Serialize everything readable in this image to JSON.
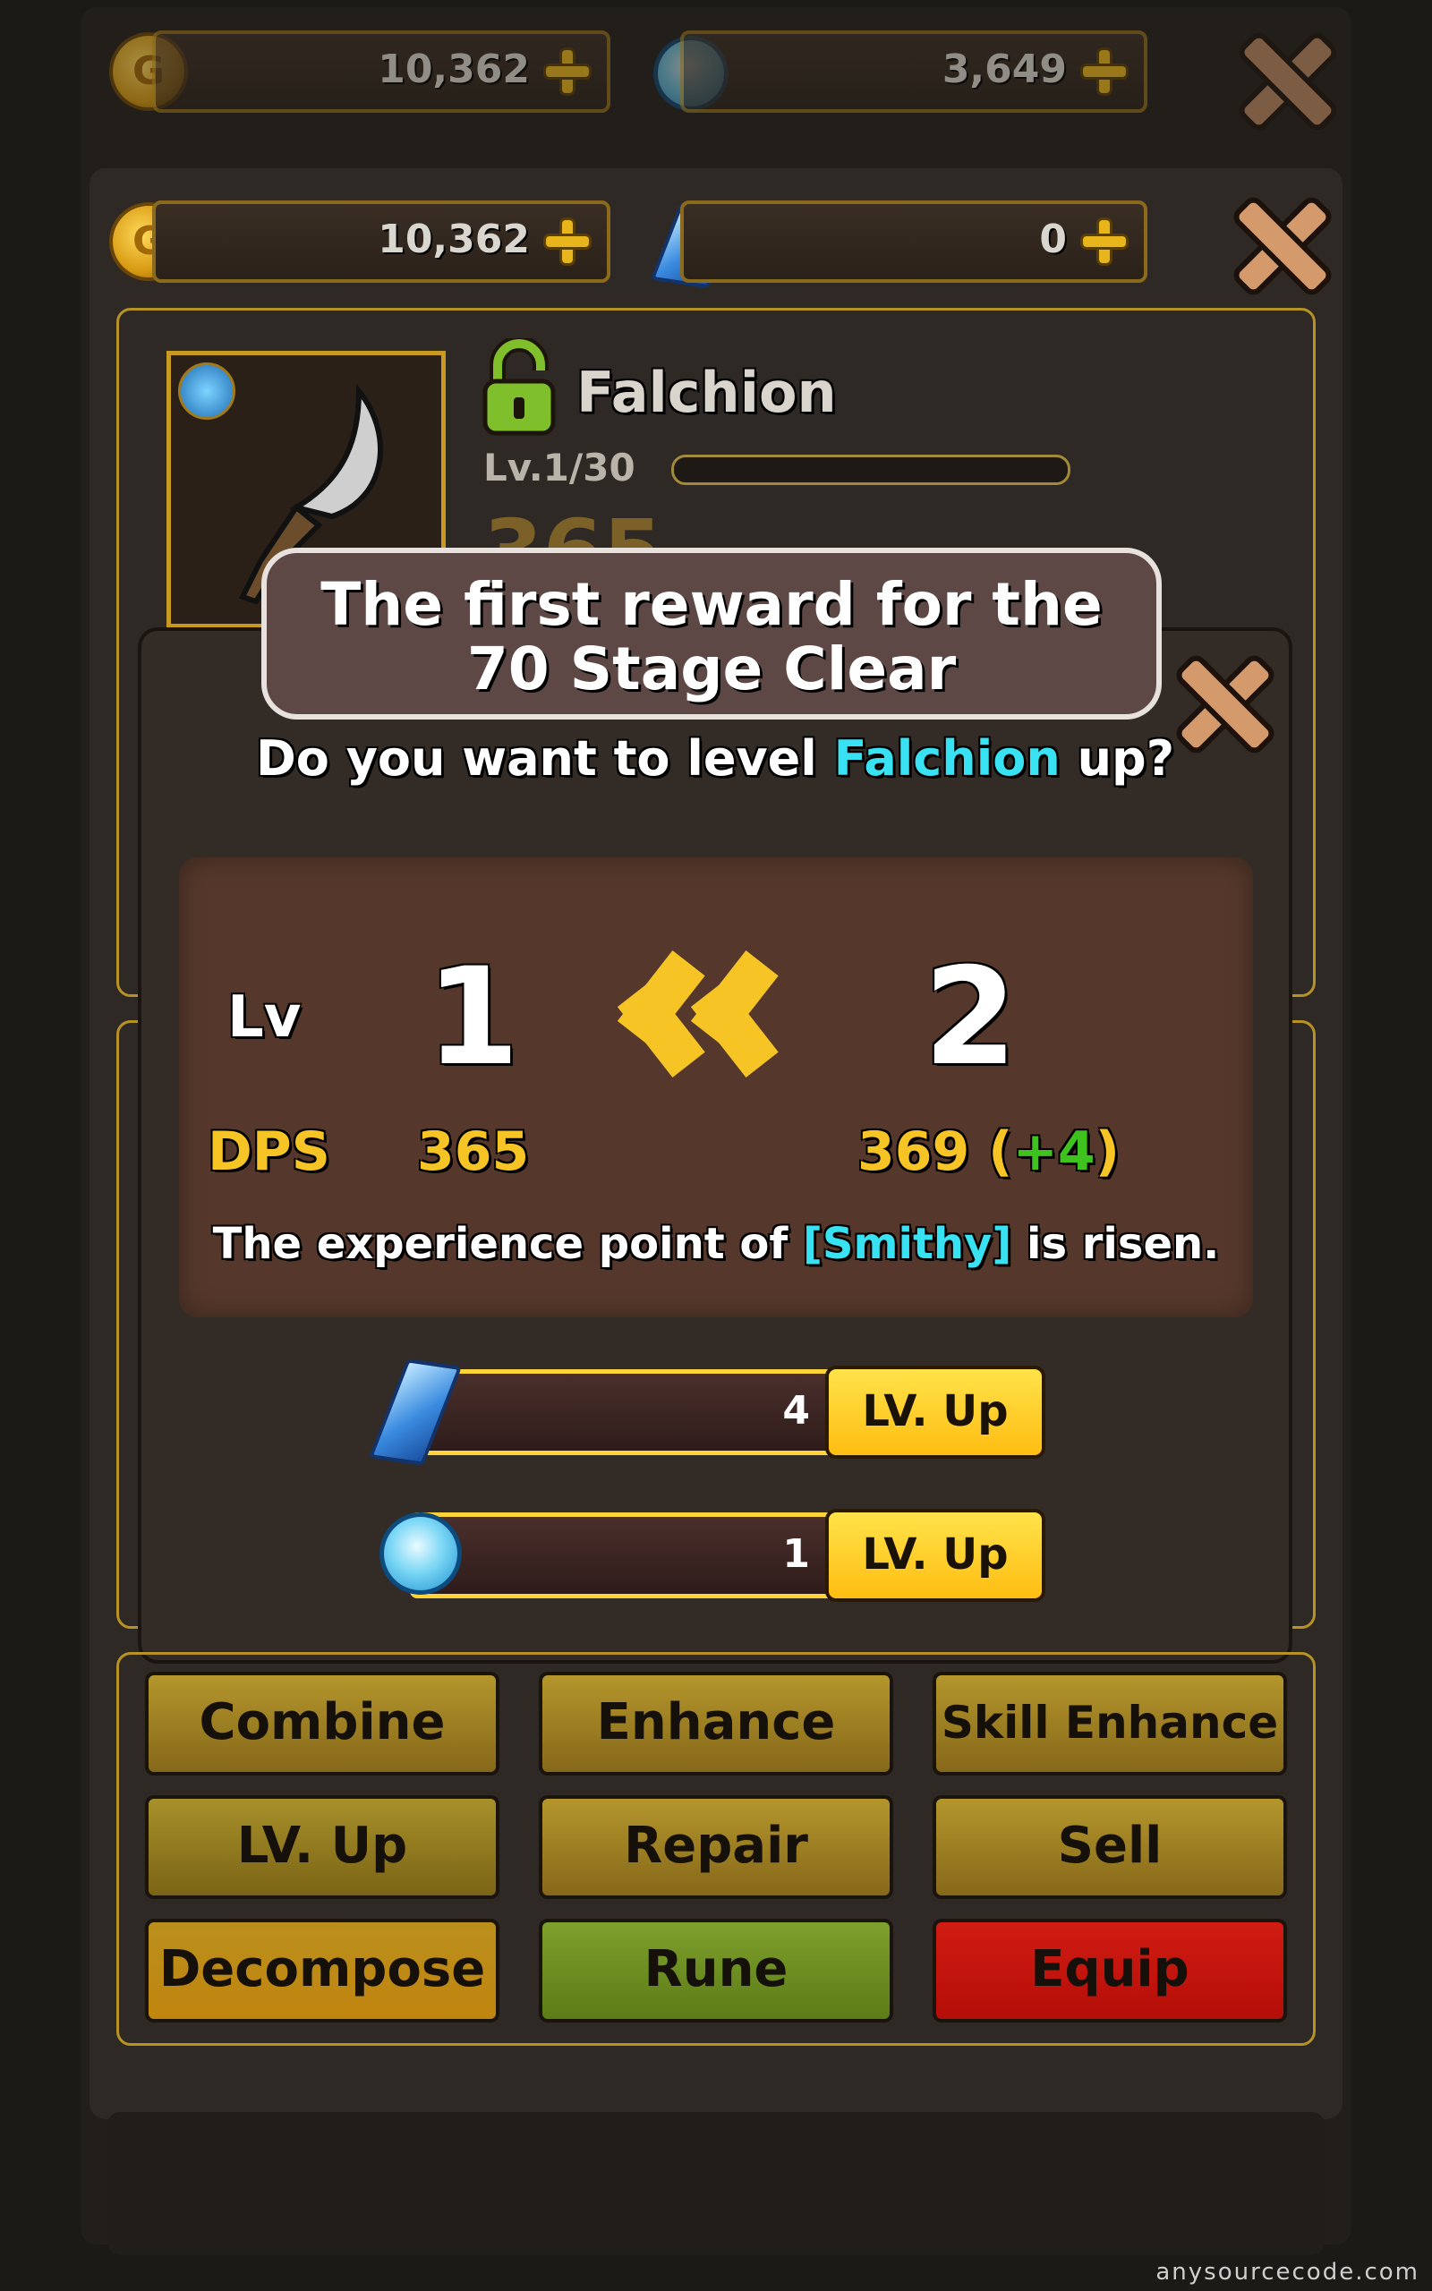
{
  "currency_back": {
    "gold": "10,362",
    "gems": "3,649"
  },
  "currency": {
    "gold": "10,362",
    "crystal": "0",
    "gold_coin_letter": "G"
  },
  "item": {
    "name": "Falchion",
    "level": "Lv.1/30",
    "level_progress": 0.0,
    "dps_partial": "365"
  },
  "dialog": {
    "title_line1": "The first reward for the",
    "title_line2": "70 Stage Clear",
    "question_prefix": "Do you want to level ",
    "question_item": "Falchion",
    "question_suffix": " up?",
    "lv_label": "Lv",
    "lv_from": "1",
    "lv_to": "2",
    "dps_label": "DPS",
    "dps_from": "365",
    "dps_to": "369",
    "dps_delta": "+4",
    "exp_prefix": "The experience point of ",
    "exp_name": "[Smithy]",
    "exp_suffix": " is risen.",
    "crystal_cost": "4",
    "diamond_cost": "1",
    "lvup_label_1": "LV. Up",
    "lvup_label_2": "LV. Up"
  },
  "actions": {
    "combine": "Combine",
    "enhance": "Enhance",
    "skill_enhance": "Skill Enhance",
    "lv_up": "LV. Up",
    "repair": "Repair",
    "sell": "Sell",
    "decompose": "Decompose",
    "rune": "Rune",
    "equip": "Equip"
  },
  "watermark": "anysourcecode.com",
  "colors": {
    "accent_cyan": "#38e2f2",
    "gold": "#f7c426",
    "green": "#3ec21d"
  }
}
